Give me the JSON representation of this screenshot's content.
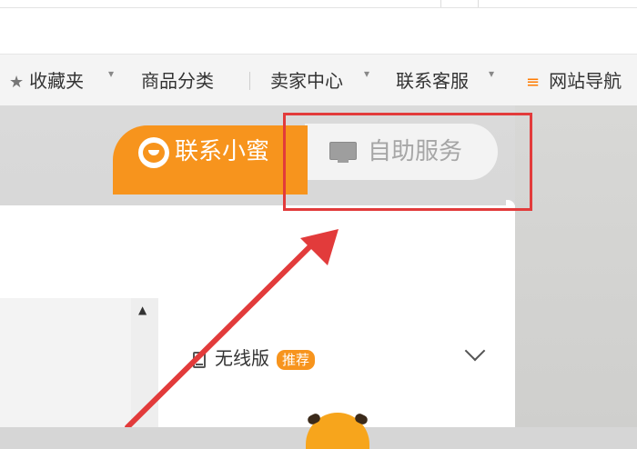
{
  "navbar": {
    "items": [
      {
        "label": "收藏夹",
        "icon": "star-icon",
        "has_dropdown": true
      },
      {
        "label": "商品分类",
        "has_dropdown": false
      },
      {
        "label": "卖家中心",
        "has_dropdown": true
      },
      {
        "label": "联系客服",
        "has_dropdown": true
      },
      {
        "label": "网站导航",
        "icon": "list-icon",
        "has_dropdown": false
      }
    ],
    "dropdown_glyph": "▾",
    "star_glyph": "★",
    "list_glyph": "≡"
  },
  "service_tabs": {
    "contact_tab": {
      "label": "联系小蜜",
      "icon": "bee-mascot-icon",
      "active": true
    },
    "self_service_tab": {
      "label": "自助服务",
      "icon": "monitor-icon",
      "active": false
    }
  },
  "mobile_section": {
    "label": "无线版",
    "badge": "推荐",
    "icon": "mobile-phone-icon",
    "expand_icon": "chevron-down-icon"
  },
  "scrollbar": {
    "up_glyph": "▲"
  },
  "annotation": {
    "highlight_color": "#e23b3b",
    "arrow_color": "#e23b3b"
  },
  "colors": {
    "accent_orange": "#f7941d",
    "inactive_tab_bg": "#f3f3f3",
    "inactive_tab_text": "#a6a6a6"
  }
}
